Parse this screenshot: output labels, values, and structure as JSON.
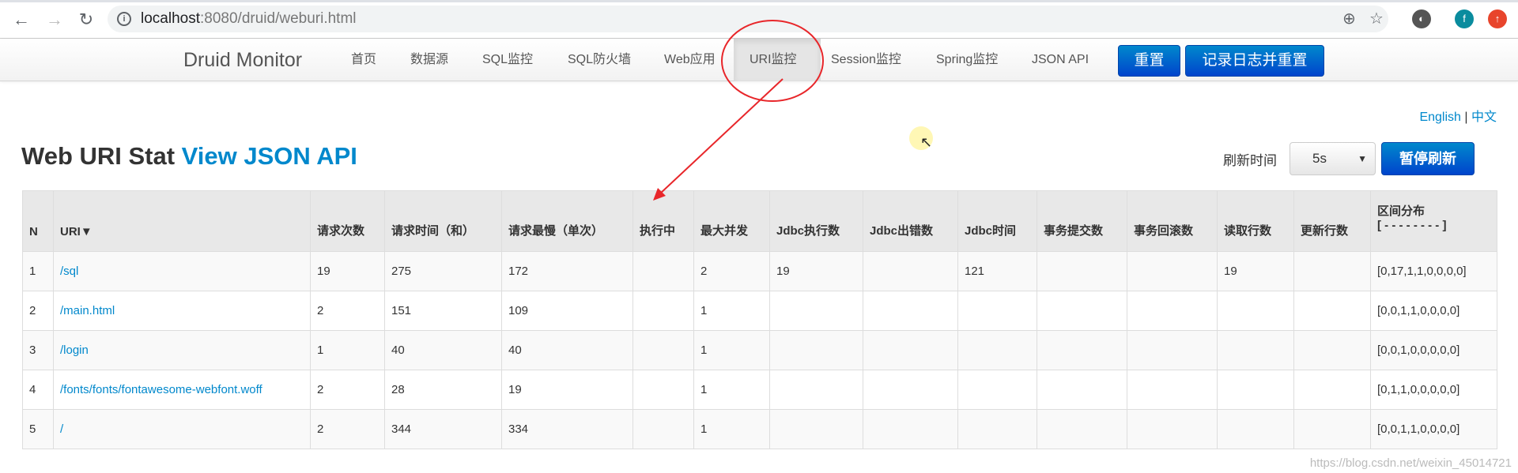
{
  "browser": {
    "url_host": "localhost",
    "url_path": ":8080/druid/weburi.html",
    "ext_f": "f"
  },
  "nav": {
    "brand": "Druid Monitor",
    "items": [
      "首页",
      "数据源",
      "SQL监控",
      "SQL防火墙",
      "Web应用",
      "URI监控",
      "Session监控",
      "Spring监控",
      "JSON API"
    ],
    "active": "URI监控",
    "reset": "重置",
    "log_reset": "记录日志并重置"
  },
  "lang": {
    "en": "English",
    "sep": "|",
    "zh": "中文"
  },
  "title": {
    "text": "Web URI Stat ",
    "link": "View JSON API"
  },
  "refresh": {
    "label": "刷新时间",
    "value": "5s",
    "pause": "暂停刷新"
  },
  "table": {
    "headers": [
      "N",
      "URI▼",
      "请求次数",
      "请求时间（和）",
      "请求最慢（单次）",
      "执行中",
      "最大并发",
      "Jdbc执行数",
      "Jdbc出错数",
      "Jdbc时间",
      "事务提交数",
      "事务回滚数",
      "读取行数",
      "更新行数",
      "区间分布"
    ],
    "header_sub": "[ - - - - - - - - ]",
    "rows": [
      [
        "1",
        "/sql",
        "19",
        "275",
        "172",
        "",
        "2",
        "19",
        "",
        "121",
        "",
        "",
        "19",
        "",
        "[0,17,1,1,0,0,0,0]"
      ],
      [
        "2",
        "/main.html",
        "2",
        "151",
        "109",
        "",
        "1",
        "",
        "",
        "",
        "",
        "",
        "",
        "",
        "[0,0,1,1,0,0,0,0]"
      ],
      [
        "3",
        "/login",
        "1",
        "40",
        "40",
        "",
        "1",
        "",
        "",
        "",
        "",
        "",
        "",
        "",
        "[0,0,1,0,0,0,0,0]"
      ],
      [
        "4",
        "/fonts/fonts/fontawesome-webfont.woff",
        "2",
        "28",
        "19",
        "",
        "1",
        "",
        "",
        "",
        "",
        "",
        "",
        "",
        "[0,1,1,0,0,0,0,0]"
      ],
      [
        "5",
        "/",
        "2",
        "344",
        "334",
        "",
        "1",
        "",
        "",
        "",
        "",
        "",
        "",
        "",
        "[0,0,1,1,0,0,0,0]"
      ]
    ]
  },
  "watermark": "https://blog.csdn.net/weixin_45014721",
  "colors": {
    "accent": "#0088cc",
    "button": "#0055cc",
    "annotation": "#e8262a"
  }
}
